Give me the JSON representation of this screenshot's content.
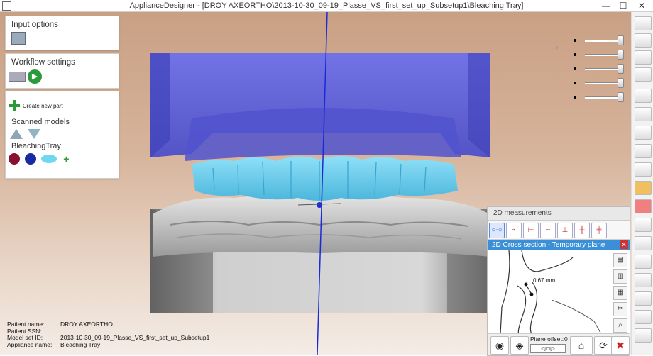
{
  "window": {
    "title": "ApplianceDesigner - [DROY AXEORTHO\\2013-10-30_09-19_Plasse_VS_first_set_up_Subsetup1\\Bleaching Tray]",
    "minimize": "—",
    "maximize": "☐",
    "close": "✕"
  },
  "left_panel": {
    "input_options": "Input options",
    "workflow_settings": "Workflow settings",
    "create_new_part": "Create new part",
    "scanned_models": "Scanned models",
    "bleaching_tray": "BleachingTray",
    "add": "+"
  },
  "measurements": {
    "title": "2D measurements",
    "cross_section": "2D Cross section - Temporary plane",
    "distance_label": "0.67 mm",
    "plane_offset_label": "Plane offset:",
    "plane_offset_value": "0"
  },
  "patient_info": [
    {
      "key": "Patient name:",
      "value": "DROY AXEORTHO"
    },
    {
      "key": "Patient SSN:",
      "value": ""
    },
    {
      "key": "Model set ID:",
      "value": "2013-10-30_09-19_Plasse_VS_first_set_up_Subsetup1"
    },
    {
      "key": "Appliance name:",
      "value": "Bleaching Tray"
    }
  ],
  "colors": {
    "tray_blue": "#5a5ee0",
    "teeth_cyan": "#6fd0f0",
    "accent": "#3a8fd6"
  }
}
